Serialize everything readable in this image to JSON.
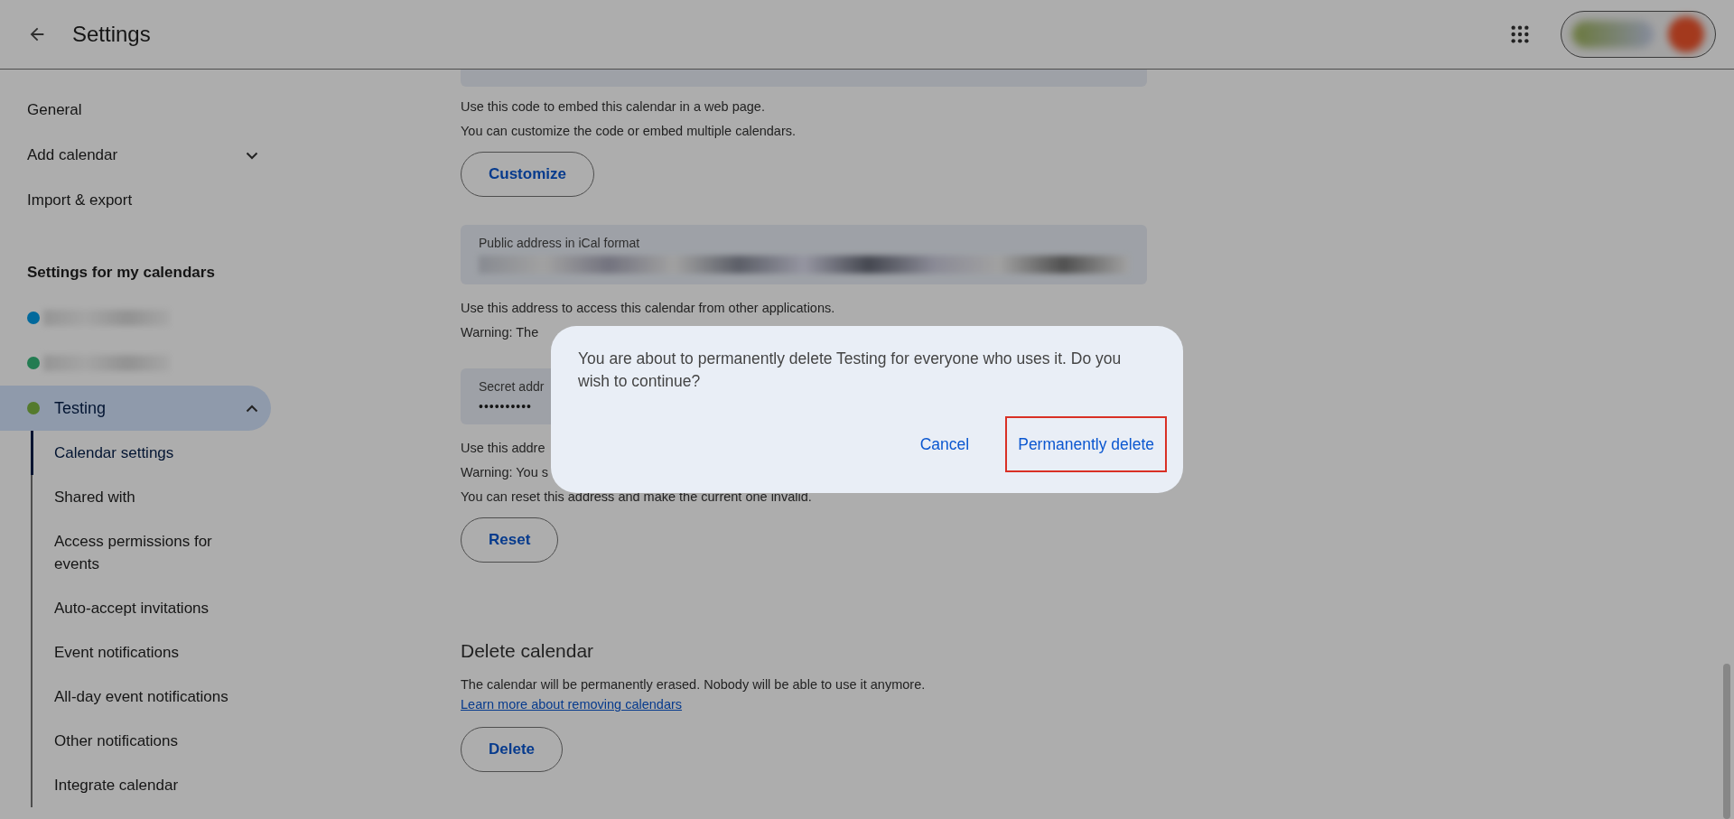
{
  "header": {
    "title": "Settings"
  },
  "sidebar": {
    "items": [
      {
        "label": "General"
      },
      {
        "label": "Add calendar",
        "expanded": false
      },
      {
        "label": "Import & export"
      }
    ],
    "section_title": "Settings for my calendars",
    "calendars": [
      {
        "color": "#02699c",
        "selected": false
      },
      {
        "color": "#237c52",
        "selected": false
      },
      {
        "name": "Testing",
        "color": "#547a2d",
        "selected": true,
        "expanded": true,
        "children": [
          {
            "label": "Calendar settings",
            "selected": true
          },
          {
            "label": "Shared with",
            "selected": false
          },
          {
            "label": "Access permissions for events",
            "selected": false
          },
          {
            "label": "Auto-accept invitations",
            "selected": false
          },
          {
            "label": "Event notifications",
            "selected": false
          },
          {
            "label": "All-day event notifications",
            "selected": false
          },
          {
            "label": "Other notifications",
            "selected": false
          },
          {
            "label": "Integrate calendar",
            "selected": false
          }
        ]
      }
    ]
  },
  "content": [
    {
      "kind": "cut-field"
    },
    {
      "kind": "text",
      "text": "Use this code to embed this calendar in a web page."
    },
    {
      "kind": "text",
      "text": "You can customize the code or embed multiple calendars."
    },
    {
      "kind": "button",
      "label": "Customize"
    },
    {
      "kind": "field",
      "label": "Public address in iCal format",
      "blurred": true
    },
    {
      "kind": "text",
      "text": "Use this address to access this calendar from other applications."
    },
    {
      "kind": "text",
      "text": "Warning: The"
    },
    {
      "kind": "field",
      "label": "Secret addr",
      "value": "••••••••••"
    },
    {
      "kind": "text",
      "text": "Use this addre"
    },
    {
      "kind": "text",
      "text": "Warning: You s"
    },
    {
      "kind": "text",
      "text": "You can reset this address and make the current one invalid."
    },
    {
      "kind": "button",
      "label": "Reset"
    },
    {
      "kind": "heading",
      "text": "Delete calendar"
    },
    {
      "kind": "paragraph",
      "text": "The calendar will be permanently erased. Nobody will be able to use it anymore.",
      "link": "Learn more about removing calendars"
    },
    {
      "kind": "button",
      "label": "Delete"
    }
  ],
  "dialog": {
    "message": "You are about to permanently delete Testing for everyone who uses it. Do you wish to continue?",
    "actions": [
      {
        "label": "Cancel",
        "highlighted": false
      },
      {
        "label": "Permanently delete",
        "highlighted": true
      }
    ]
  }
}
